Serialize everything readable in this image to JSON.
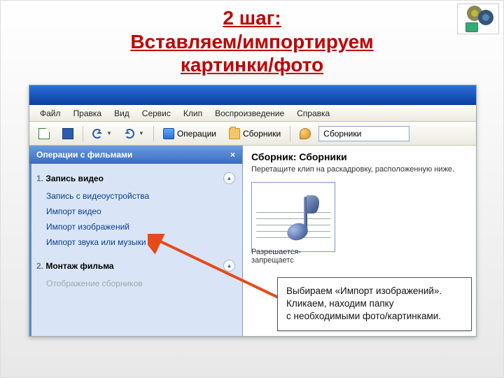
{
  "heading": {
    "line1": "2 шаг:",
    "line2": "Вставляем/импортируем",
    "line3": "картинки/фото"
  },
  "menubar": {
    "file": "Файл",
    "edit": "Правка",
    "view": "Вид",
    "tools": "Сервис",
    "clip": "Клип",
    "playback": "Воспроизведение",
    "help": "Справка"
  },
  "toolbar": {
    "operations": "Операции",
    "collections": "Сборники",
    "combo_value": "Сборники"
  },
  "taskpane": {
    "title": "Операции с фильмами",
    "section1_num": "1.",
    "section1_label": "Запись видео",
    "links": {
      "capture": "Запись с видеоустройства",
      "import_video": "Импорт видео",
      "import_images": "Импорт изображений",
      "import_audio": "Импорт звука или музыки"
    },
    "section2_num": "2.",
    "section2_label": "Монтаж фильма",
    "disabled": "Отображение сборников"
  },
  "mainpane": {
    "title": "Сборник: Сборники",
    "hint": "Перетащите клип на раскадровку, расположенную ниже.",
    "thumb_label": "Разрешается-запрещаетс"
  },
  "callout": {
    "line1": "Выбираем «Импорт изображений».",
    "line2": "Кликаем, находим папку",
    "line3": "с необходимыми фото/картинками."
  }
}
